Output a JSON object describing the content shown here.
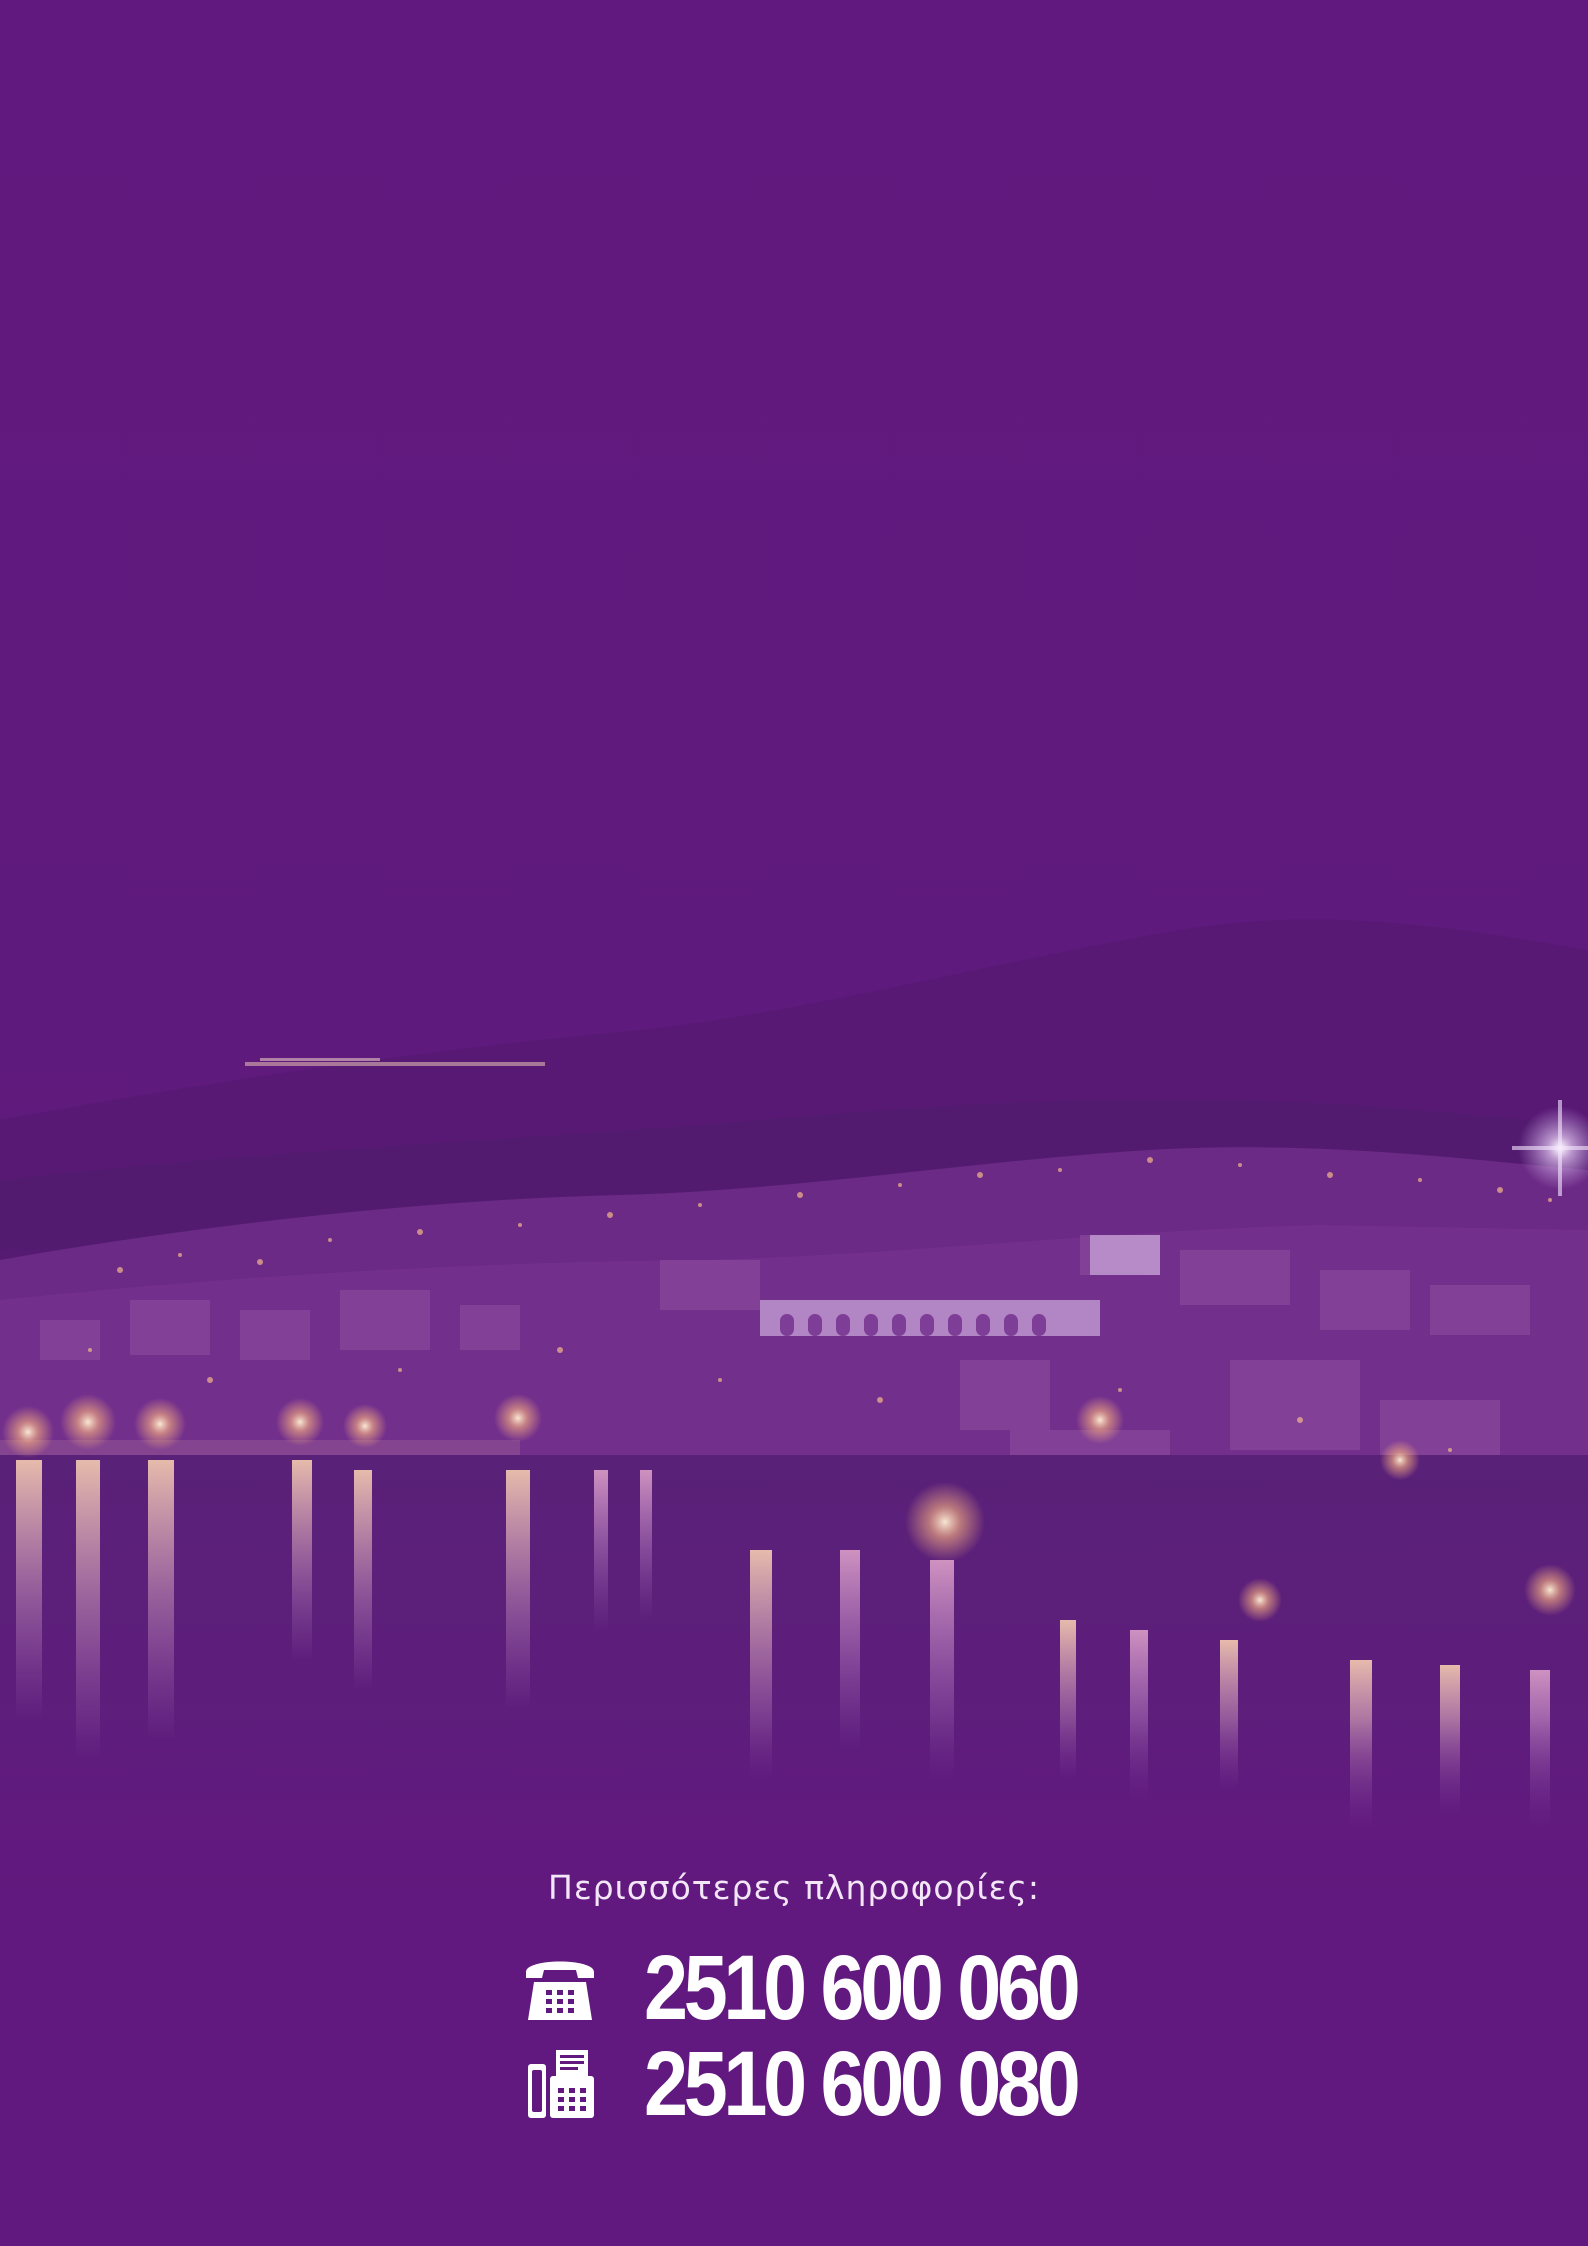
{
  "background": {
    "color": "#62197f",
    "photo_tint": "#62197f",
    "subject": "night-city-harbor-photo"
  },
  "contact": {
    "label": "Περισσότερες πληροφορίες:",
    "phone": {
      "icon": "telephone-icon",
      "number": "2510 600 060"
    },
    "fax": {
      "icon": "fax-icon",
      "number": "2510 600 080"
    }
  }
}
